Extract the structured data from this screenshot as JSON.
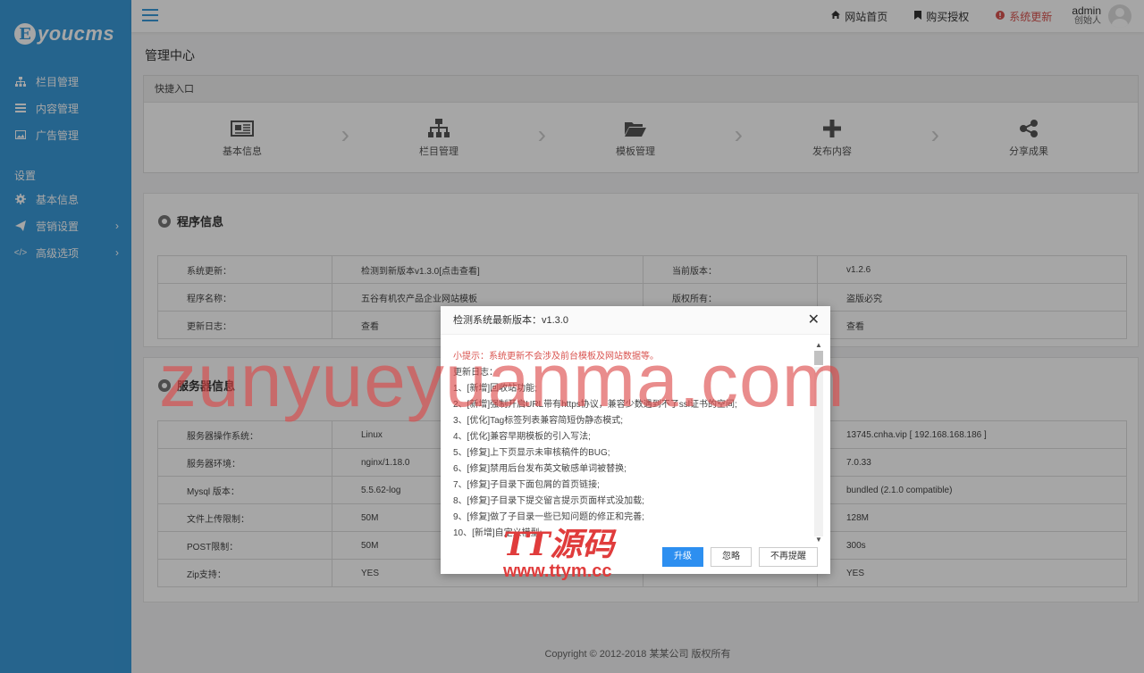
{
  "brand": {
    "logo_letter": "E",
    "logo_text": "youcms",
    "color": "#3a9ad9"
  },
  "sidebar": {
    "items": [
      {
        "label": "栏目管理",
        "icon": "sitemap-icon"
      },
      {
        "label": "内容管理",
        "icon": "list-icon"
      },
      {
        "label": "广告管理",
        "icon": "image-icon"
      }
    ],
    "group_label": "设置",
    "settings": [
      {
        "label": "基本信息",
        "icon": "gear-icon"
      },
      {
        "label": "营销设置",
        "icon": "send-icon"
      },
      {
        "label": "高级选项",
        "icon": "code-icon"
      }
    ]
  },
  "topbar": {
    "site_home": "网站首页",
    "buy_license": "购买授权",
    "system_update": "系统更新",
    "admin_name": "admin",
    "admin_role": "创始人"
  },
  "page": {
    "title": "管理中心"
  },
  "quick": {
    "header": "快捷入口",
    "items": [
      "基本信息",
      "栏目管理",
      "模板管理",
      "发布内容",
      "分享成果"
    ]
  },
  "program": {
    "title": "程序信息",
    "rows": [
      {
        "k": "系统更新：",
        "v": "检测到新版本v1.3.0[点击查看]",
        "k2": "当前版本：",
        "v2": "v1.2.6"
      },
      {
        "k": "程序名称：",
        "v": "五谷有机农产品企业网站模板",
        "k2": "版权所有：",
        "v2": "盗版必究"
      },
      {
        "k": "更新日志：",
        "v": "查看",
        "k2": "",
        "v2": "查看"
      }
    ]
  },
  "server": {
    "title": "服务器信息",
    "rows": [
      {
        "k": "服务器操作系统：",
        "v": "Linux",
        "v2": "13745.cnha.vip [ 192.168.168.186 ]"
      },
      {
        "k": "服务器环境：",
        "v": "nginx/1.18.0",
        "v2": "7.0.33"
      },
      {
        "k": "Mysql 版本：",
        "v": "5.5.62-log",
        "v2": "bundled (2.1.0 compatible)"
      },
      {
        "k": "文件上传限制：",
        "v": "50M",
        "v2": "128M"
      },
      {
        "k": "POST限制：",
        "v": "50M",
        "v2": "300s"
      },
      {
        "k": "Zip支持：",
        "v": "YES",
        "v2": "YES"
      }
    ]
  },
  "footer": "Copyright © 2012-2018 某某公司 版权所有",
  "modal": {
    "title": "检测系统最新版本：v1.3.0",
    "tip": "小提示：系统更新不会涉及前台模板及网站数据等。",
    "log_label": "更新日志：",
    "lines": [
      "1、[新增]回收站功能;",
      "2、[新增]强制开启URL带有https协议，兼容少数遇到不了ssl证书的空间;",
      "3、[优化]Tag标签列表兼容简短伪静态模式;",
      "4、[优化]兼容早期模板的引入写法;",
      "5、[修复]上下页显示未审核稿件的BUG;",
      "6、[修复]禁用后台发布英文敏感单词被替换;",
      "7、[修复]子目录下面包屑的首页链接;",
      "8、[修复]子目录下提交留言提示页面样式没加载;",
      "9、[修复]做了子目录一些已知问题的修正和完善;",
      "10、[新增]自定义模型;"
    ],
    "btn_upgrade": "升级",
    "btn_ignore": "忽略",
    "btn_never": "不再提醒"
  },
  "watermark": {
    "big": "zunyueyuanma.com",
    "logo_top": "TT源码",
    "logo_bottom": "www.ttym.cc"
  }
}
